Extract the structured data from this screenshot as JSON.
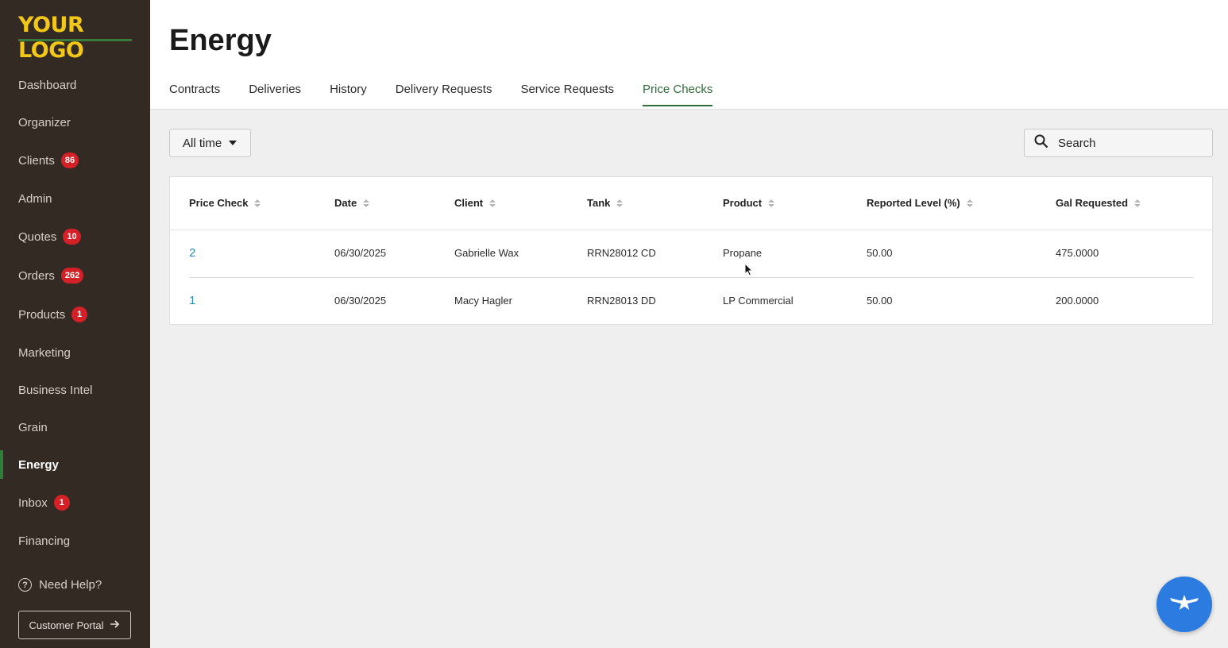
{
  "sidebar": {
    "logo": "YOUR LOGO",
    "items": [
      {
        "label": "Dashboard",
        "badge": null
      },
      {
        "label": "Organizer",
        "badge": null
      },
      {
        "label": "Clients",
        "badge": "86"
      },
      {
        "label": "Admin",
        "badge": null
      },
      {
        "label": "Quotes",
        "badge": "10"
      },
      {
        "label": "Orders",
        "badge": "262"
      },
      {
        "label": "Products",
        "badge": "1"
      },
      {
        "label": "Marketing",
        "badge": null
      },
      {
        "label": "Business Intel",
        "badge": null
      },
      {
        "label": "Grain",
        "badge": null
      },
      {
        "label": "Energy",
        "badge": null,
        "active": true
      },
      {
        "label": "Inbox",
        "badge": "1"
      },
      {
        "label": "Financing",
        "badge": null
      }
    ],
    "help_label": "Need Help?",
    "portal_label": "Customer Portal"
  },
  "header": {
    "title": "Energy",
    "tabs": [
      "Contracts",
      "Deliveries",
      "History",
      "Delivery Requests",
      "Service Requests",
      "Price Checks"
    ],
    "active_tab": "Price Checks"
  },
  "filters": {
    "time_label": "All time",
    "search_placeholder": "Search"
  },
  "table": {
    "columns": [
      "Price Check",
      "Date",
      "Client",
      "Tank",
      "Product",
      "Reported Level (%)",
      "Gal Requested"
    ],
    "rows": [
      [
        "2",
        "06/30/2025",
        "Gabrielle Wax",
        "RRN28012 CD",
        "Propane",
        "50.00",
        "475.0000"
      ],
      [
        "1",
        "06/30/2025",
        "Macy Hagler",
        "RRN28013 DD",
        "LP Commercial",
        "50.00",
        "200.0000"
      ]
    ]
  },
  "colors": {
    "sidebar_bg": "#332a24",
    "logo": "#f2c718",
    "accent_green": "#2f6b3a",
    "badge_red": "#d42027",
    "link_blue": "#2a8db5",
    "fab_blue": "#2b7be0"
  }
}
